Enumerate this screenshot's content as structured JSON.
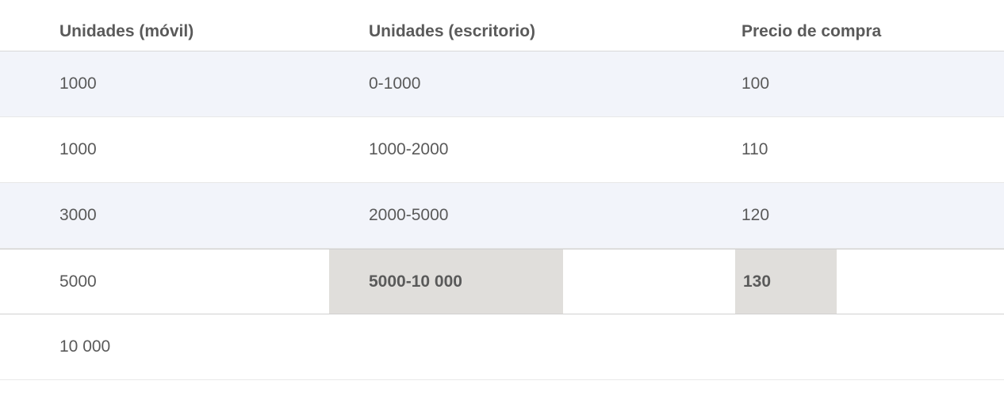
{
  "headers": {
    "col1": "Unidades (móvil)",
    "col2": "Unidades (escritorio)",
    "col3": "Precio de compra"
  },
  "rows": [
    {
      "mobile": "1000",
      "desktop": "0-1000",
      "price": "100"
    },
    {
      "mobile": "1000",
      "desktop": "1000-2000",
      "price": "110"
    },
    {
      "mobile": "3000",
      "desktop": "2000-5000",
      "price": "120"
    },
    {
      "mobile": "5000",
      "desktop": "5000-10 000",
      "price": "130"
    },
    {
      "mobile": "10 000",
      "desktop": "",
      "price": ""
    }
  ]
}
